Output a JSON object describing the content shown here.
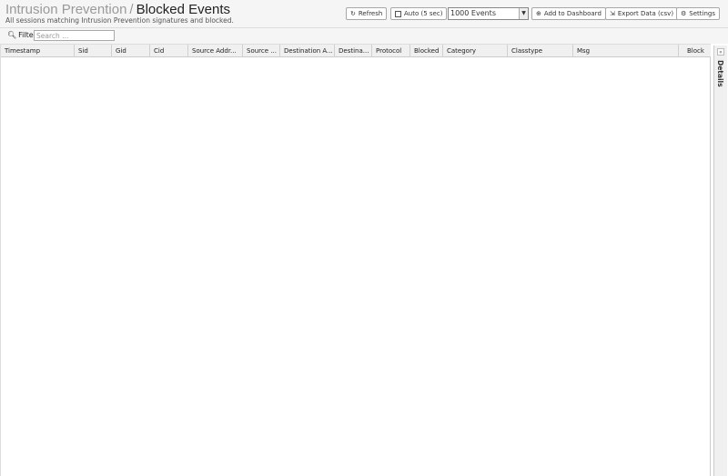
{
  "header": {
    "breadcrumb_parent": "Intrusion Prevention",
    "breadcrumb_separator": "/",
    "title": "Blocked Events",
    "subtitle": "All sessions matching Intrusion Prevention signatures and blocked."
  },
  "toolbar": {
    "refresh_label": "Refresh",
    "auto_label": "Auto (5 sec)",
    "auto_checked": false,
    "events_selected": "1000 Events",
    "add_dashboard_label": "Add to Dashboard",
    "export_label": "Export Data (csv)",
    "settings_label": "Settings"
  },
  "filter": {
    "label": "Filter",
    "placeholder": "Search ...",
    "value": ""
  },
  "grid": {
    "columns": [
      "Timestamp",
      "Sid",
      "Gid",
      "Cid",
      "Source Addr...",
      "Source ...",
      "Destination A...",
      "Destina...",
      "Protocol",
      "Blocked",
      "Category",
      "Classtype",
      "Msg",
      "Block"
    ],
    "rows": []
  },
  "details": {
    "label": "Details"
  }
}
